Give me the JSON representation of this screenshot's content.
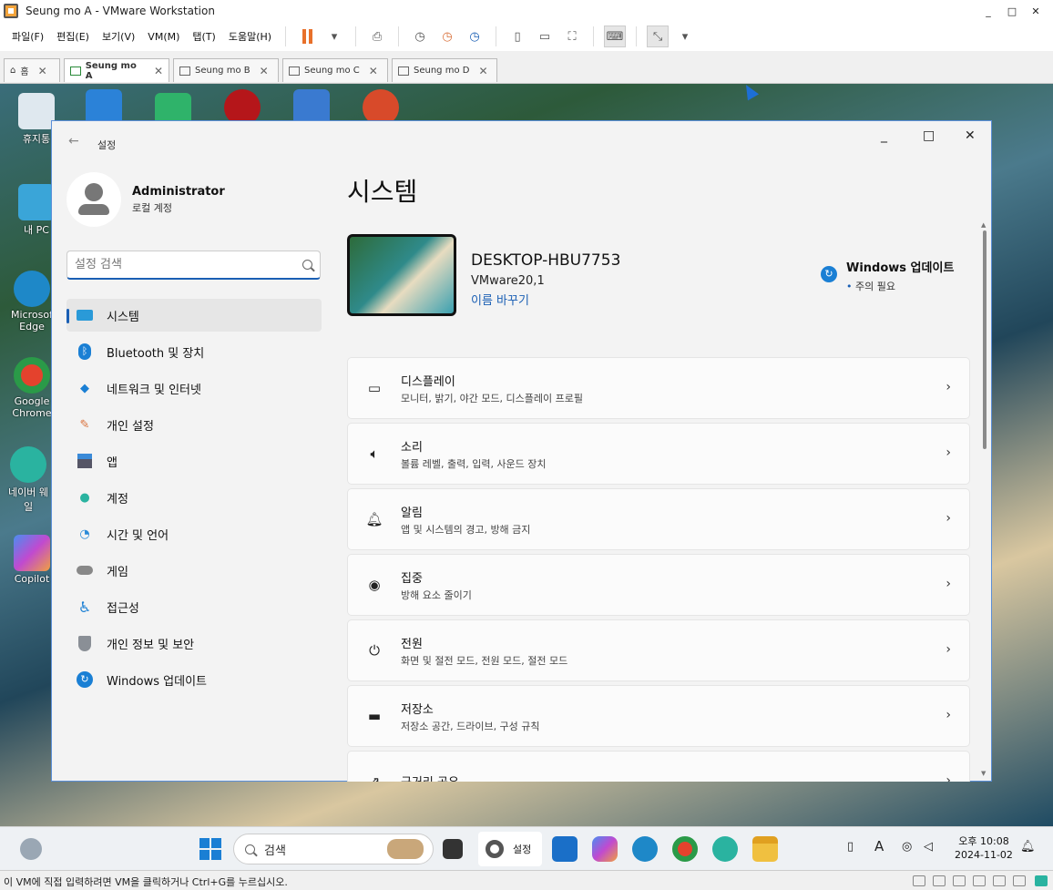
{
  "window": {
    "title": "Seung mo A - VMware Workstation",
    "min": "_",
    "max": "□",
    "close": "✕"
  },
  "menubar": [
    "파일(F)",
    "편집(E)",
    "보기(V)",
    "VM(M)",
    "탭(T)",
    "도움말(H)"
  ],
  "tabs": [
    {
      "label": "홈"
    },
    {
      "label": "Seung mo A"
    },
    {
      "label": "Seung mo B"
    },
    {
      "label": "Seung mo C"
    },
    {
      "label": "Seung mo D"
    }
  ],
  "desktop_icons": [
    {
      "label": "휴지통"
    },
    {
      "label": "내 PC"
    },
    {
      "label": "Microsoft Edge"
    },
    {
      "label": "Google Chrome"
    },
    {
      "label": "네이버 웨일"
    },
    {
      "label": "Copilot"
    }
  ],
  "settings": {
    "app_title": "설정",
    "back": "←",
    "profile": {
      "name": "Administrator",
      "sub": "로컬 계정"
    },
    "search_placeholder": "설정 검색",
    "nav": [
      {
        "label": "시스템",
        "icon": "monitor-icon"
      },
      {
        "label": "Bluetooth 및 장치",
        "icon": "bluetooth-icon"
      },
      {
        "label": "네트워크 및 인터넷",
        "icon": "wifi-icon"
      },
      {
        "label": "개인 설정",
        "icon": "brush-icon"
      },
      {
        "label": "앱",
        "icon": "apps-icon"
      },
      {
        "label": "계정",
        "icon": "account-icon"
      },
      {
        "label": "시간 및 언어",
        "icon": "clock-globe-icon"
      },
      {
        "label": "게임",
        "icon": "gamepad-icon"
      },
      {
        "label": "접근성",
        "icon": "accessibility-icon"
      },
      {
        "label": "개인 정보 및 보안",
        "icon": "shield-icon"
      },
      {
        "label": "Windows 업데이트",
        "icon": "update-icon"
      }
    ],
    "heading": "시스템",
    "device": {
      "name": "DESKTOP-HBU7753",
      "model": "VMware20,1",
      "rename": "이름 바꾸기"
    },
    "update": {
      "title": "Windows 업데이트",
      "status": "주의 필요"
    },
    "cards": [
      {
        "title": "디스플레이",
        "sub": "모니터, 밝기, 야간 모드, 디스플레이 프로필",
        "icon": "display-icon"
      },
      {
        "title": "소리",
        "sub": "볼륨 레벨, 출력, 입력, 사운드 장치",
        "icon": "speaker-icon"
      },
      {
        "title": "알림",
        "sub": "앱 및 시스템의 경고, 방해 금지",
        "icon": "bell-icon"
      },
      {
        "title": "집중",
        "sub": "방해 요소 줄이기",
        "icon": "focus-icon"
      },
      {
        "title": "전원",
        "sub": "화면 및 절전 모드, 전원 모드, 절전 모드",
        "icon": "power-icon"
      },
      {
        "title": "저장소",
        "sub": "저장소 공간, 드라이브, 구성 규칙",
        "icon": "storage-icon"
      },
      {
        "title": "근거리 공유",
        "sub": "",
        "icon": "share-icon"
      }
    ]
  },
  "taskbar": {
    "search": "검색",
    "settings_app": "설정",
    "clock": {
      "time": "오후 10:08",
      "date": "2024-11-02"
    },
    "ime": "A"
  },
  "statusbar": {
    "text": "이 VM에 직접 입력하려면 VM을 클릭하거나 Ctrl+G를 누르십시오."
  },
  "colors": {
    "accent": "#1a5fb4",
    "pause": "#e8702a"
  }
}
